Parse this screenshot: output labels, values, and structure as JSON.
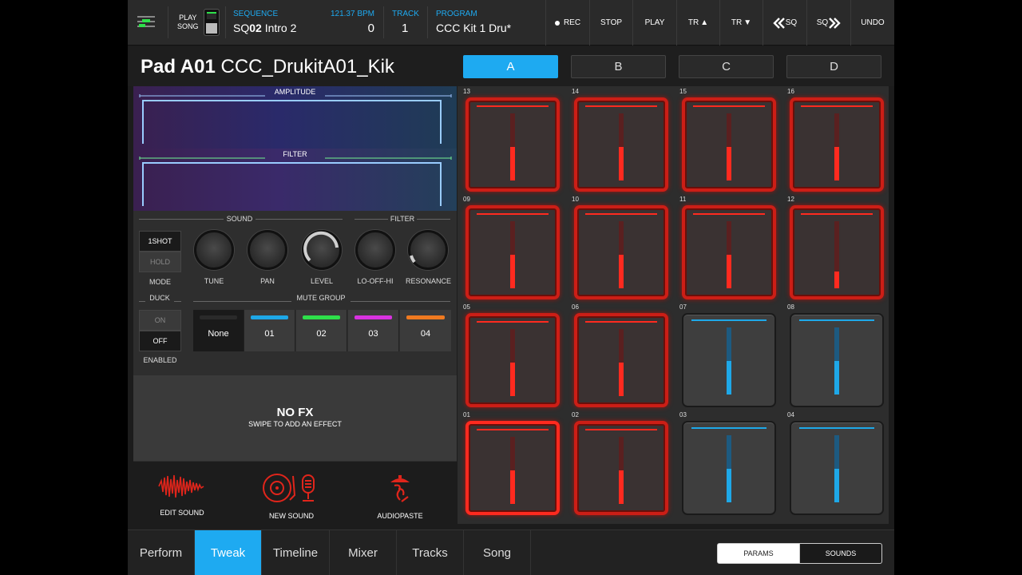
{
  "colors": {
    "accent": "#1eaaf1",
    "pad_red": "#ff2a1f",
    "pad_blue": "#1ea8e8"
  },
  "topbar": {
    "play_song": [
      "PLAY",
      "SONG"
    ],
    "sequence_label": "SEQUENCE",
    "sequence_prefix": "SQ",
    "sequence_number": "02",
    "sequence_name": "Intro 2",
    "bpm": "121.37 BPM",
    "bpm_value": "0",
    "track_label": "TRACK",
    "track_value": "1",
    "program_label": "PROGRAM",
    "program_value": "CCC Kit 1 Dru*",
    "buttons": [
      "REC",
      "STOP",
      "PLAY",
      "TR",
      "TR",
      "SQ",
      "SQ",
      "UNDO"
    ]
  },
  "pad_header": {
    "pad": "Pad A01",
    "sample": "CCC_DrukitA01_Kik"
  },
  "banks": [
    "A",
    "B",
    "C",
    "D"
  ],
  "envelopes": {
    "amplitude": "AMPLITUDE",
    "filter": "FILTER"
  },
  "sound_section": "SOUND",
  "filter_section": "FILTER",
  "mode": {
    "options": [
      "1SHOT",
      "HOLD"
    ],
    "label": "MODE"
  },
  "knobs": [
    "TUNE",
    "PAN",
    "LEVEL",
    "LO-OFF-HI",
    "RESONANCE"
  ],
  "duck": {
    "title": "DUCK",
    "options": [
      "ON",
      "OFF"
    ],
    "label": "ENABLED"
  },
  "mute_group": {
    "title": "MUTE GROUP",
    "cells": [
      {
        "label": "None",
        "color": "#2a2a2a"
      },
      {
        "label": "01",
        "color": "#1ea8e8"
      },
      {
        "label": "02",
        "color": "#2ee04a"
      },
      {
        "label": "03",
        "color": "#d832e0"
      },
      {
        "label": "04",
        "color": "#f07a20"
      }
    ]
  },
  "fx": {
    "title": "NO FX",
    "subtitle": "SWIPE TO ADD AN EFFECT"
  },
  "tools": [
    "EDIT SOUND",
    "NEW SOUND",
    "AUDIOPASTE"
  ],
  "pads": [
    {
      "num": "13",
      "color": "red",
      "level": 0.5
    },
    {
      "num": "14",
      "color": "red",
      "level": 0.5
    },
    {
      "num": "15",
      "color": "red",
      "level": 0.5
    },
    {
      "num": "16",
      "color": "red",
      "level": 0.5
    },
    {
      "num": "09",
      "color": "red",
      "level": 0.5
    },
    {
      "num": "10",
      "color": "red",
      "level": 0.5
    },
    {
      "num": "11",
      "color": "red",
      "level": 0.5
    },
    {
      "num": "12",
      "color": "red",
      "level": 0.25
    },
    {
      "num": "05",
      "color": "red",
      "level": 0.5
    },
    {
      "num": "06",
      "color": "red",
      "level": 0.5
    },
    {
      "num": "07",
      "color": "blue",
      "level": 0.5
    },
    {
      "num": "08",
      "color": "blue",
      "level": 0.5
    },
    {
      "num": "01",
      "color": "red",
      "level": 0.5,
      "hit": true
    },
    {
      "num": "02",
      "color": "red",
      "level": 0.5
    },
    {
      "num": "03",
      "color": "blue",
      "level": 0.5
    },
    {
      "num": "04",
      "color": "blue",
      "level": 0.5
    }
  ],
  "tabs": [
    "Perform",
    "Tweak",
    "Timeline",
    "Mixer",
    "Tracks",
    "Song"
  ],
  "active_tab": "Tweak",
  "view_toggle": [
    "PARAMS",
    "SOUNDS"
  ]
}
